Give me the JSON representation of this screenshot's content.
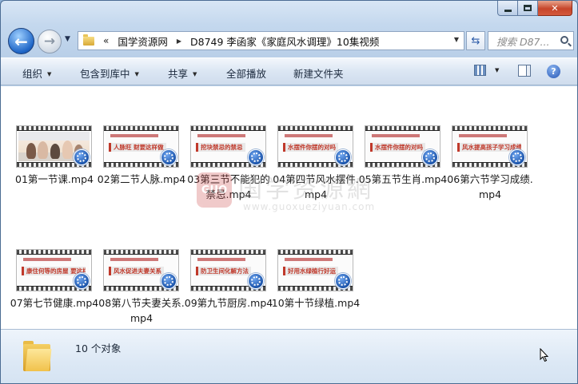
{
  "window": {
    "caption_buttons": {
      "minimize": "minimize",
      "maximize": "maximize",
      "close": "✕"
    }
  },
  "address_bar": {
    "overflow_label": "«",
    "parts": [
      "国学资源网",
      "D8749 李函家《家庭风水调理》10集视频"
    ],
    "search_placeholder": "搜索 D87..."
  },
  "toolbar": {
    "organize": "组织",
    "include_in_library": "包含到库中",
    "share": "共享",
    "play_all": "全部播放",
    "new_folder": "新建文件夹"
  },
  "files": [
    {
      "name": "01第一节课.mp4",
      "thumb_text": "",
      "thumb_kind": "photo"
    },
    {
      "name": "02第二节人脉.mp4",
      "thumb_text": "人脉旺 财要这样做",
      "thumb_kind": "slide"
    },
    {
      "name": "03第三节不能犯的禁忌.mp4",
      "thumb_text": "挖块禁忌的禁忌",
      "thumb_kind": "slide"
    },
    {
      "name": "04第四节风水摆件.mp4",
      "thumb_text": "水摆件你摆的对吗",
      "thumb_kind": "slide"
    },
    {
      "name": "05第五节生肖.mp4",
      "thumb_text": "水摆件你摆的对吗",
      "thumb_kind": "slide"
    },
    {
      "name": "06第六节学习成绩.mp4",
      "thumb_text": "风水提高孩子学习成绩",
      "thumb_kind": "slide"
    },
    {
      "name": "07第七节健康.mp4",
      "thumb_text": "康住何等的房屋 要这样做",
      "thumb_kind": "slide"
    },
    {
      "name": "08第八节夫妻关系.mp4",
      "thumb_text": "风水促进夫妻关系",
      "thumb_kind": "slide"
    },
    {
      "name": "09第九节厨房.mp4",
      "thumb_text": "防卫生间化解方法",
      "thumb_kind": "slide"
    },
    {
      "name": "10第十节绿植.mp4",
      "thumb_text": "好用水绿植行好运",
      "thumb_kind": "slide"
    }
  ],
  "status": {
    "item_count": "10 个对象"
  },
  "colors": {
    "accent": "#1f66c7",
    "slide_red": "#c0392b",
    "close_red": "#c6452a"
  }
}
